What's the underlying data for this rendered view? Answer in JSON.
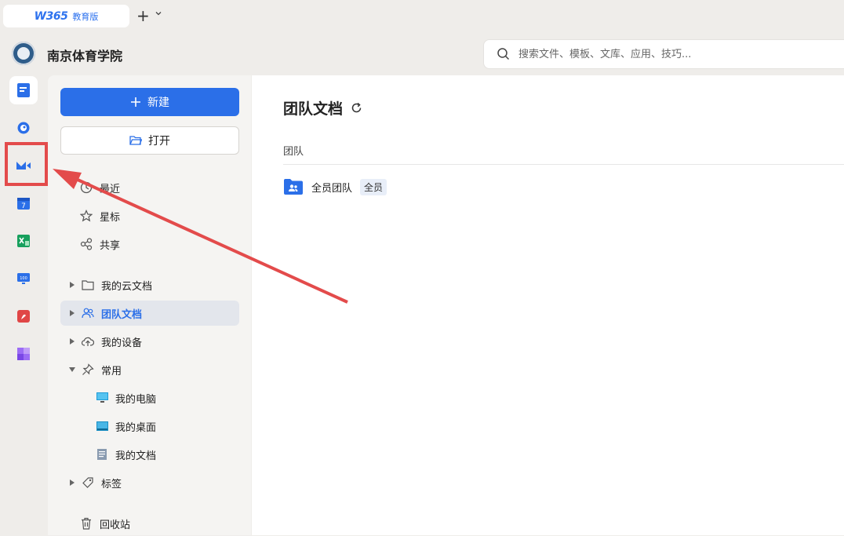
{
  "tab": {
    "logo": "W365",
    "edition": "教育版"
  },
  "header": {
    "org_name": "南京体育学院"
  },
  "search": {
    "placeholder": "搜索文件、模板、文库、应用、技巧..."
  },
  "rail": [
    {
      "name": "docs-icon",
      "active": true
    },
    {
      "name": "chat-icon"
    },
    {
      "name": "meeting-icon"
    },
    {
      "name": "calendar-icon"
    },
    {
      "name": "sheet-icon"
    },
    {
      "name": "screen-icon"
    },
    {
      "name": "pdf-icon"
    },
    {
      "name": "apps-icon"
    }
  ],
  "sidebar": {
    "new_label": "新建",
    "open_label": "打开",
    "quick": [
      {
        "label": "最近"
      },
      {
        "label": "星标"
      },
      {
        "label": "共享"
      }
    ],
    "tree": {
      "my_cloud": "我的云文档",
      "team_docs": "团队文档",
      "my_devices": "我的设备",
      "common": "常用",
      "my_computer": "我的电脑",
      "my_desktop": "我的桌面",
      "my_documents": "我的文档",
      "tags": "标签",
      "recycle": "回收站"
    }
  },
  "main": {
    "title": "团队文档",
    "column_header": "团队",
    "rows": [
      {
        "name": "全员团队",
        "badge": "全员"
      }
    ]
  },
  "colors": {
    "accent": "#2b6fe8",
    "annotation": "#e34b4b"
  }
}
